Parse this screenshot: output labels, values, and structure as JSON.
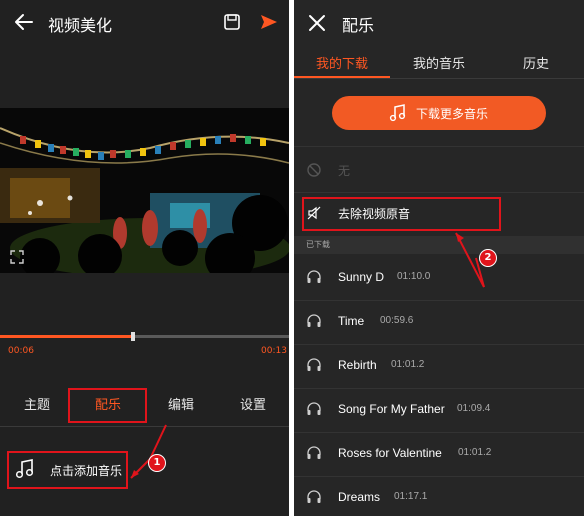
{
  "left": {
    "title": "视频美化",
    "time_current": "00:06",
    "time_total": "00:13",
    "progress_fraction": 0.46,
    "tabs": [
      {
        "label": "主题"
      },
      {
        "label": "配乐"
      },
      {
        "label": "编辑"
      },
      {
        "label": "设置"
      }
    ],
    "active_tab": 1,
    "add_music_label": "点击添加音乐",
    "badge": "1"
  },
  "right": {
    "title": "配乐",
    "tabs": [
      {
        "label": "我的下载"
      },
      {
        "label": "我的音乐"
      },
      {
        "label": "历史"
      }
    ],
    "active_tab": 0,
    "download_more_label": "下载更多音乐",
    "none_label": "无",
    "remove_original_label": "去除视频原音",
    "downloaded_header": "已下载",
    "badge": "2",
    "songs": [
      {
        "name": "Sunny D",
        "duration": "01:10.0"
      },
      {
        "name": "Time",
        "duration": "00:59.6"
      },
      {
        "name": "Rebirth",
        "duration": "01:01.2"
      },
      {
        "name": "Song For My Father",
        "duration": "01:09.4"
      },
      {
        "name": "Roses for Valentine",
        "duration": "01:01.2"
      },
      {
        "name": "Dreams",
        "duration": "01:17.1"
      }
    ]
  },
  "colors": {
    "accent": "#ff5722",
    "annotation_red": "#e0141b",
    "panel_bg": "#212121"
  },
  "icons": [
    "back-arrow-icon",
    "save-icon",
    "send-icon",
    "expand-icon",
    "music-note-icon",
    "close-icon",
    "no-entry-icon",
    "mute-icon",
    "headphones-icon"
  ]
}
